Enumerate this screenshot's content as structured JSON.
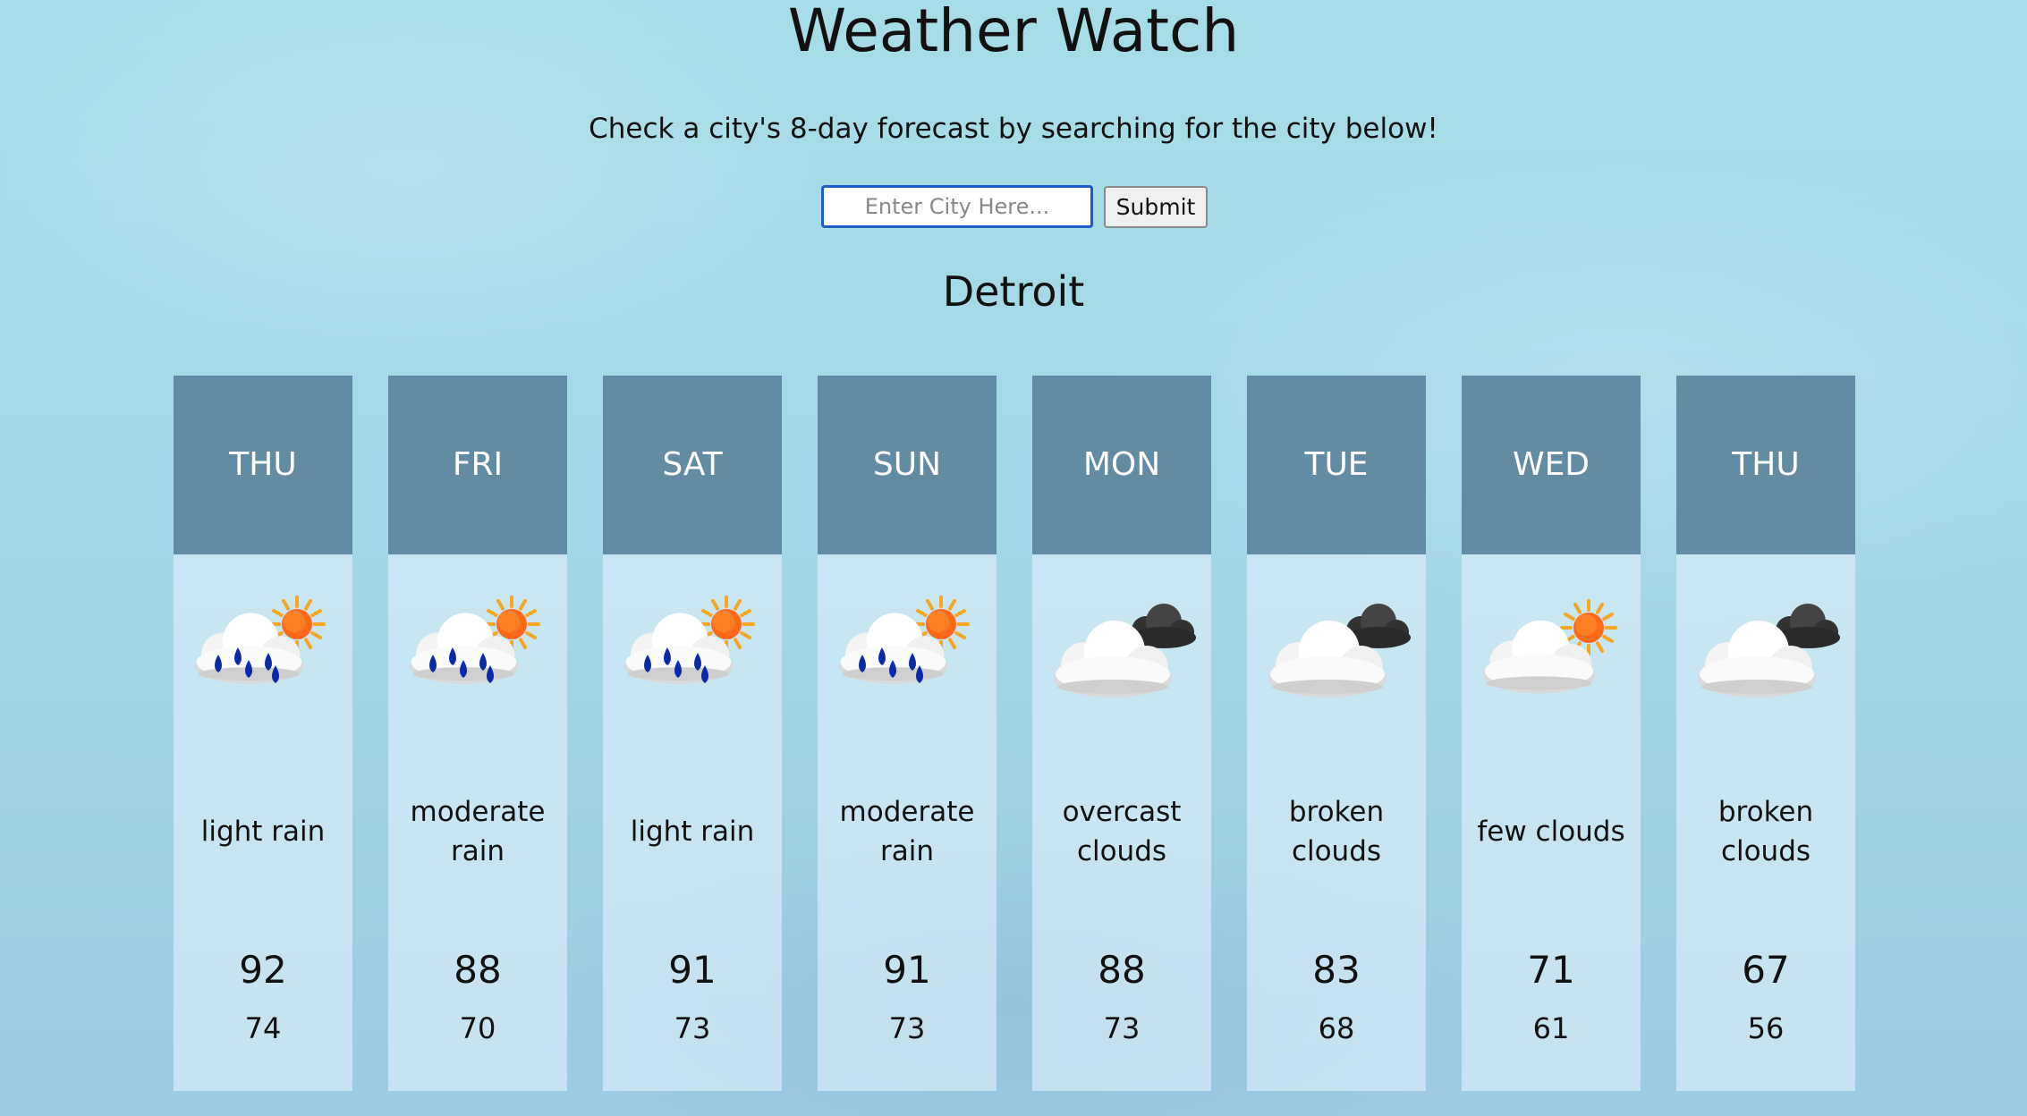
{
  "header": {
    "title": "Weather Watch",
    "subtitle": "Check a city's 8-day forecast by searching for the city below!"
  },
  "search": {
    "placeholder": "Enter City Here...",
    "value": "",
    "submit_label": "Submit"
  },
  "city": "Detroit",
  "colors": {
    "header_bg": "#628ca3",
    "rain_drop": "#0a2aa8",
    "sun": "#f5a623",
    "dark_cloud": "#333333"
  },
  "forecast": [
    {
      "day": "THU",
      "description": "light rain",
      "high": "92",
      "low": "74",
      "icon": "rain-sun-icon"
    },
    {
      "day": "FRI",
      "description": "moderate rain",
      "high": "88",
      "low": "70",
      "icon": "rain-sun-icon"
    },
    {
      "day": "SAT",
      "description": "light rain",
      "high": "91",
      "low": "73",
      "icon": "rain-sun-icon"
    },
    {
      "day": "SUN",
      "description": "moderate rain",
      "high": "91",
      "low": "73",
      "icon": "rain-sun-icon"
    },
    {
      "day": "MON",
      "description": "overcast clouds",
      "high": "88",
      "low": "73",
      "icon": "overcast-clouds-icon"
    },
    {
      "day": "TUE",
      "description": "broken clouds",
      "high": "83",
      "low": "68",
      "icon": "broken-clouds-icon"
    },
    {
      "day": "WED",
      "description": "few clouds",
      "high": "71",
      "low": "61",
      "icon": "few-clouds-icon"
    },
    {
      "day": "THU",
      "description": "broken clouds",
      "high": "67",
      "low": "56",
      "icon": "broken-clouds-icon"
    }
  ]
}
